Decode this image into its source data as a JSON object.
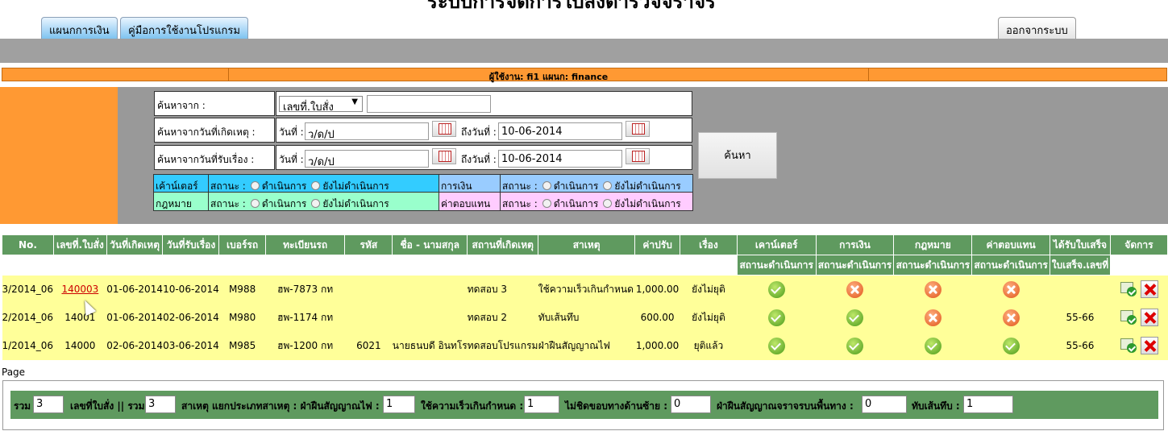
{
  "header": {
    "title": "ระบบการจัดการใบสั่งตำรวจจราจร",
    "tabs": [
      {
        "label": "แผนกการเงิน"
      },
      {
        "label": "คู่มือการใช้งานโปรแกรม"
      }
    ],
    "logout_label": "ออกจากระบบ"
  },
  "userbar": {
    "text": "ผู้ใช้งาน: fi1    แผนก: finance"
  },
  "search": {
    "row1": {
      "label": "ค้นหาจาก :",
      "select_value": "เลขที่.ใบสั่ง",
      "text_value": ""
    },
    "row2": {
      "label": "ค้นหาจากวันที่เกิดเหตุ :",
      "from_label": "วันที่ :",
      "from_value": "ว/ด/ป",
      "to_label": "ถึงวันที่ :",
      "to_value": "10-06-2014"
    },
    "row3": {
      "label": "ค้นหาจากวันที่รับเรื่อง :",
      "from_label": "วันที่ :",
      "from_value": "ว/ด/ป",
      "to_label": "ถึงวันที่ :",
      "to_value": "10-06-2014"
    },
    "button_label": "ค้นหา",
    "status_label": "สถานะ :",
    "opt_done": "ดำเนินการ",
    "opt_pending": "ยังไม่ดำเนินการ",
    "depts": {
      "counter": "เค้าน์เตอร์",
      "finance": "การเงิน",
      "law": "กฎหมาย",
      "comp": "ค่าตอบแทน"
    }
  },
  "table": {
    "headers": [
      "No.",
      "เลขที่.ใบสั่ง",
      "วันที่เกิดเหตุ",
      "วันที่รับเรื่อง",
      "เบอร์รถ",
      "ทะเบียนรถ",
      "รหัส",
      "ชื่อ - นามสกุล",
      "สถานที่เกิดเหตุ",
      "สาเหตุ",
      "ค่าปรับ",
      "เรื่อง",
      "เคาน์เตอร์",
      "การเงิน",
      "กฎหมาย",
      "ค่าตอบแทน",
      "ได้รับใบเสร็จ",
      "จัดการ"
    ],
    "sub_status": "สถานะดำเนินการ",
    "sub_receipt": "ใบเสร็จ.เลขที่",
    "rows": [
      {
        "no": "3/2014_06",
        "ticket": "140003",
        "incident_date": "01-06-2014",
        "received_date": "10-06-2014",
        "car_no": "M988",
        "plate": "ฮพ-7873 กท",
        "code": "",
        "name": "",
        "place": "ทดสอบ 3",
        "cause": "ใช้ความเร็วเกินกำหนด",
        "fine": "1,000.00",
        "case": "ยังไม่ยุติ",
        "status": [
          "ok",
          "no",
          "no",
          "no"
        ],
        "receipt": ""
      },
      {
        "no": "2/2014_06",
        "ticket": "14001",
        "incident_date": "01-06-2014",
        "received_date": "02-06-2014",
        "car_no": "M980",
        "plate": "ฮพ-1174 กท",
        "code": "",
        "name": "",
        "place": "ทดสอบ 2",
        "cause": "ทับเส้นทึบ",
        "fine": "600.00",
        "case": "ยังไม่ยุติ",
        "status": [
          "ok",
          "ok",
          "no",
          "no"
        ],
        "receipt": "55-66"
      },
      {
        "no": "1/2014_06",
        "ticket": "14000",
        "incident_date": "02-06-2014",
        "received_date": "03-06-2014",
        "car_no": "M985",
        "plate": "ฮพ-1200 กท",
        "code": "6021",
        "name": "นายธนบดี อินทโร",
        "place": "ทดสอบโปรแกรม",
        "cause": "ฝ่าฝืนสัญญาณไฟ",
        "fine": "1,000.00",
        "case": "ยุติแล้ว",
        "status": [
          "ok",
          "ok",
          "ok",
          "ok"
        ],
        "receipt": "55-66"
      }
    ]
  },
  "page_label": "Page",
  "summary": {
    "total_label": "รวม",
    "total_value": "3",
    "ticket_label": "เลขที่ใบสั่ง || รวม",
    "ticket_value": "3",
    "cause_label": "สาเหตุ  แยกประเภทสาเหตุ : ฝ่าฝืนสัญญาณไฟ :",
    "c1_value": "1",
    "c2_label": "ใช้ความเร็วเกินกำหนด :",
    "c2_value": "1",
    "c3_label": "ไม่ชิดขอบทางด้านซ้าย :",
    "c3_value": "0",
    "c4_label": "ฝ่าฝืนสัญญาณจราจรบนพื้นทาง :",
    "c4_value": "0",
    "c5_label": "ทับเส้นทึบ :",
    "c5_value": "1"
  }
}
